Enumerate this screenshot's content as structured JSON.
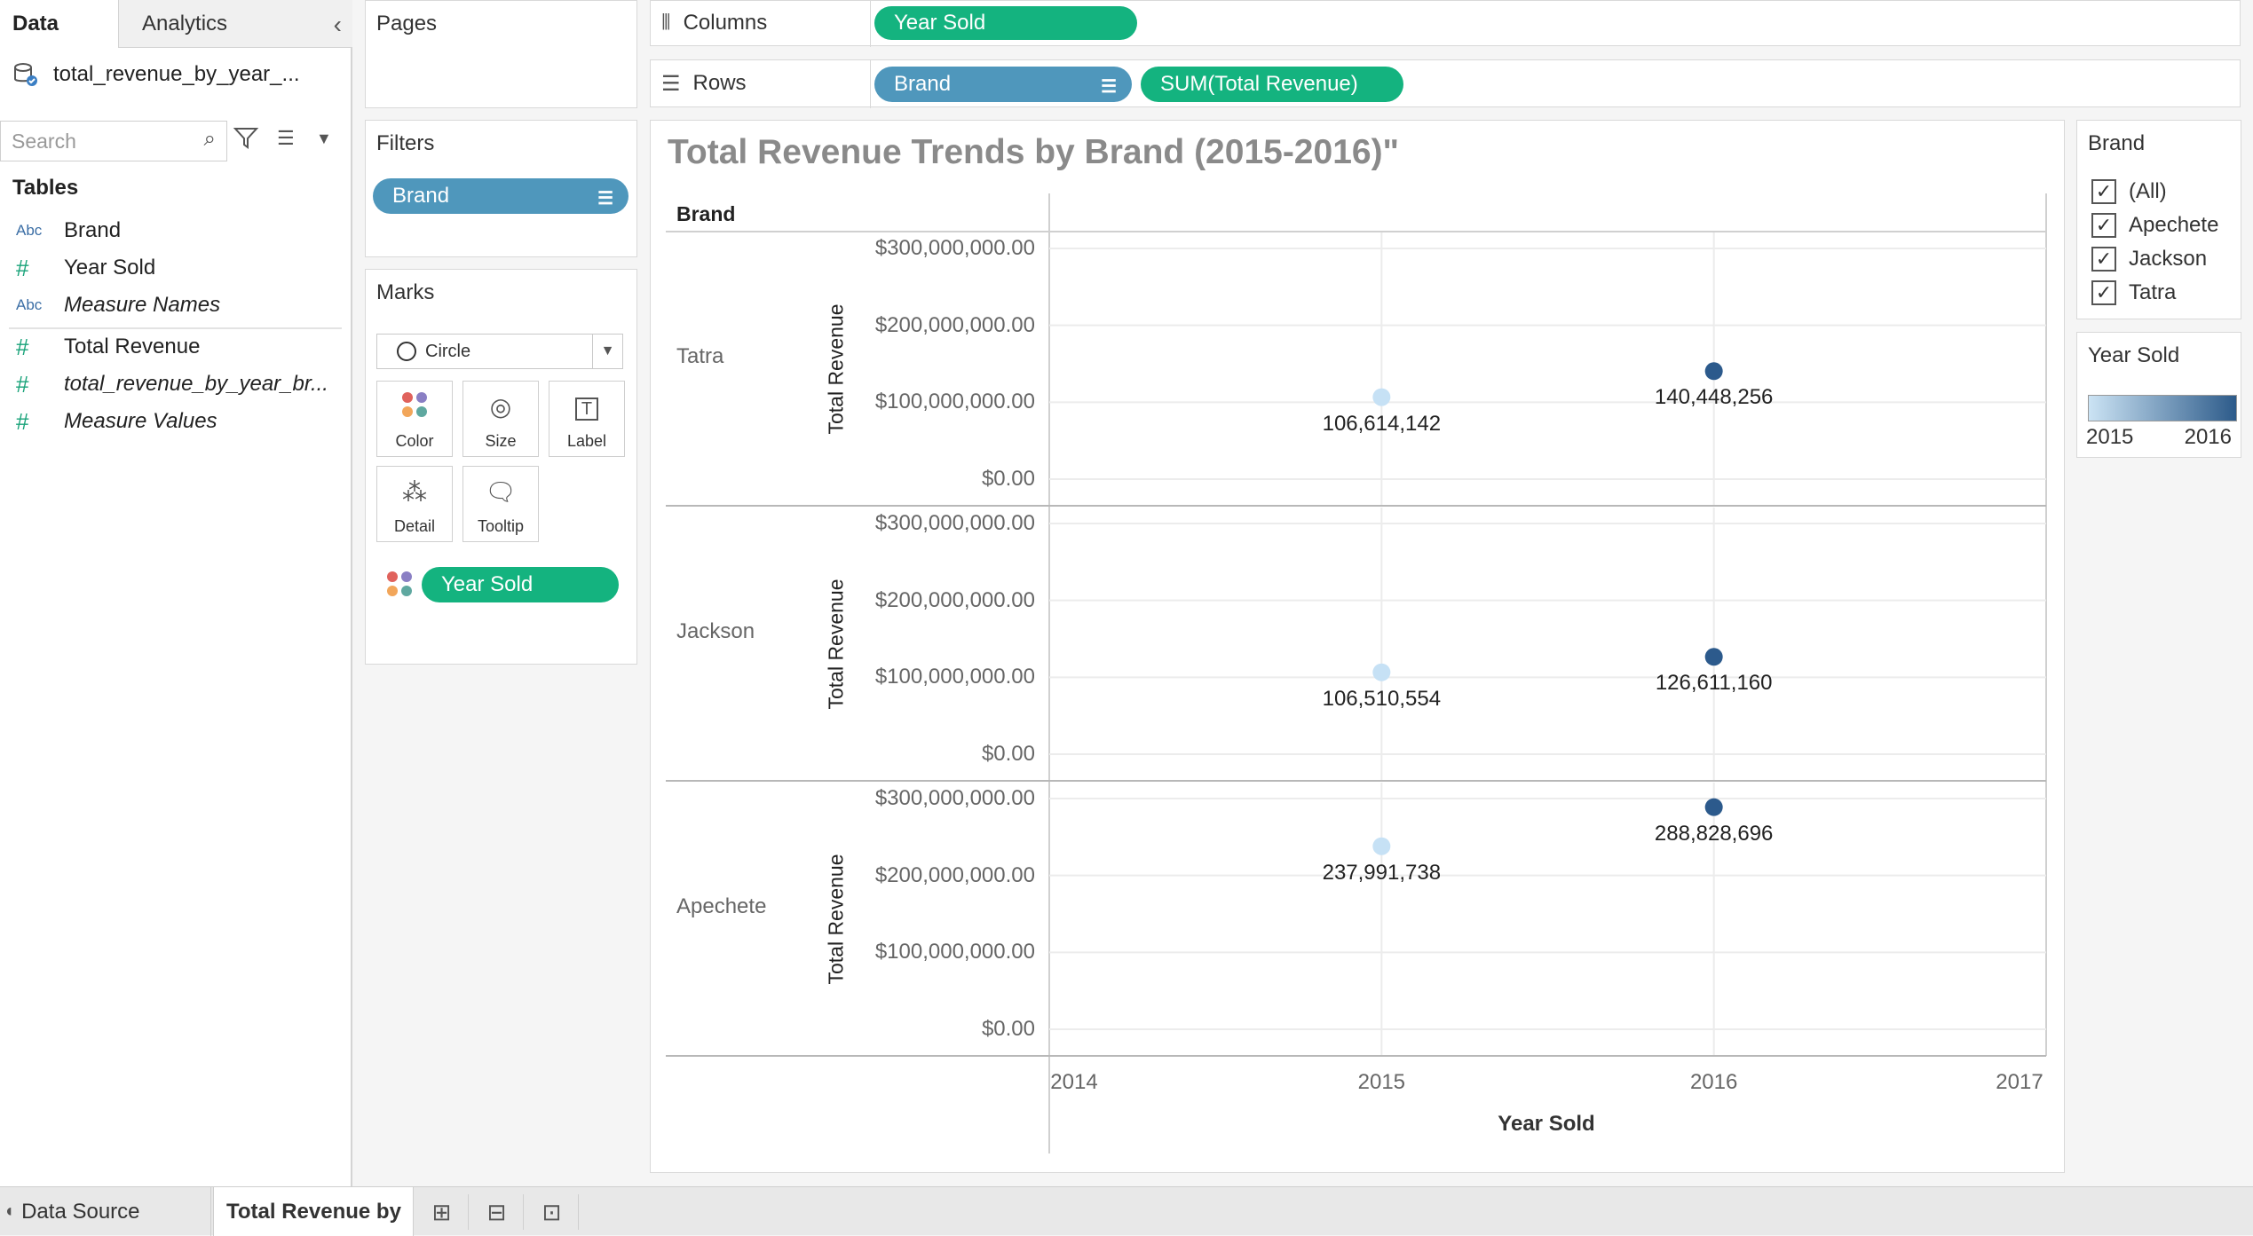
{
  "data_pane": {
    "tab_data": "Data",
    "tab_analytics": "Analytics",
    "datasource_name": "total_revenue_by_year_...",
    "search_placeholder": "Search",
    "tables_heading": "Tables",
    "fields": [
      {
        "type": "Abc",
        "name": "Brand",
        "italic": false
      },
      {
        "type": "#",
        "name": "Year Sold",
        "italic": false
      },
      {
        "type": "Abc",
        "name": "Measure Names",
        "italic": true
      },
      {
        "type": "#",
        "name": "Total Revenue",
        "italic": false
      },
      {
        "type": "#",
        "name": "total_revenue_by_year_br...",
        "italic": true
      },
      {
        "type": "#",
        "name": "Measure Values",
        "italic": true
      }
    ]
  },
  "pages": {
    "title": "Pages"
  },
  "filters": {
    "title": "Filters",
    "pills": [
      "Brand"
    ]
  },
  "marks": {
    "title": "Marks",
    "mark_type": "Circle",
    "buttons": [
      "Color",
      "Size",
      "Label",
      "Detail",
      "Tooltip"
    ],
    "color_pill": "Year Sold"
  },
  "shelves": {
    "columns_label": "Columns",
    "columns_pills": [
      "Year Sold"
    ],
    "rows_label": "Rows",
    "rows_pills": [
      "Brand",
      "SUM(Total Revenue)"
    ]
  },
  "legends": {
    "brand_title": "Brand",
    "brand_items": [
      "(All)",
      "Apechete",
      "Jackson",
      "Tatra"
    ],
    "year_title": "Year Sold",
    "year_min": "2015",
    "year_max": "2016",
    "colors": {
      "low": "#c6e1f5",
      "high": "#2c5a8c"
    }
  },
  "chart_data": {
    "type": "scatter",
    "title": "Total Revenue Trends by Brand (2015-2016)\"",
    "row_header": "Brand",
    "xlabel": "Year Sold",
    "ylabel": "Total Revenue",
    "x_ticks": [
      "2014",
      "2015",
      "2016",
      "2017"
    ],
    "xlim": [
      2014,
      2017
    ],
    "y_ticks": [
      "$300,000,000.00",
      "$200,000,000.00",
      "$100,000,000.00",
      "$0.00"
    ],
    "ylim": [
      0,
      300000000
    ],
    "panels": [
      {
        "brand": "Tatra",
        "points": [
          {
            "x": 2015,
            "y": 106614142,
            "label": "106,614,142"
          },
          {
            "x": 2016,
            "y": 140448256,
            "label": "140,448,256"
          }
        ]
      },
      {
        "brand": "Jackson",
        "points": [
          {
            "x": 2015,
            "y": 106510554,
            "label": "106,510,554"
          },
          {
            "x": 2016,
            "y": 126611160,
            "label": "126,611,160"
          }
        ]
      },
      {
        "brand": "Apechete",
        "points": [
          {
            "x": 2015,
            "y": 237991738,
            "label": "237,991,738"
          },
          {
            "x": 2016,
            "y": 288828696,
            "label": "288,828,696"
          }
        ]
      }
    ]
  },
  "bottom_tabs": {
    "data_source": "Data Source",
    "sheet": "Total Revenue by"
  }
}
